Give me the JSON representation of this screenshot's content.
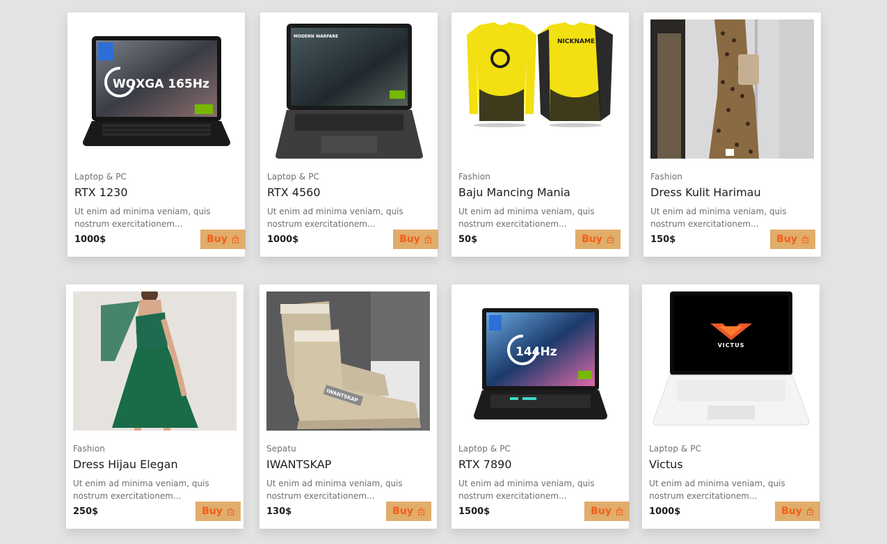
{
  "colors": {
    "background": "#e3e3e3",
    "card": "#ffffff",
    "buy_button_bg": "#e0ad6b",
    "buy_button_text": "#f35d1a"
  },
  "buy_label": "Buy",
  "products": [
    {
      "category": "Laptop & PC",
      "title": "RTX 1230",
      "description": "Ut enim ad minima veniam, quis nostrum exercitationem...",
      "price": "1000$",
      "image_text": "WQXGA 165Hz",
      "image": "laptop-black-gaming"
    },
    {
      "category": "Laptop & PC",
      "title": "RTX 4560",
      "description": "Ut enim ad minima veniam, quis nostrum exercitationem...",
      "price": "1000$",
      "image_text": "MODERN WARFARE",
      "image": "laptop-gray-gaming"
    },
    {
      "category": "Fashion",
      "title": "Baju Mancing Mania",
      "description": "Ut enim ad minima veniam, quis nostrum exercitationem...",
      "price": "50$",
      "image_text": "NICKNAME",
      "image": "yellow-fishing-jersey"
    },
    {
      "category": "Fashion",
      "title": "Dress Kulit Harimau",
      "description": "Ut enim ad minima veniam, quis nostrum exercitationem...",
      "price": "150$",
      "image": "leopard-print-dress"
    },
    {
      "category": "Fashion",
      "title": "Dress Hijau Elegan",
      "description": "Ut enim ad minima veniam, quis nostrum exercitationem...",
      "price": "250$",
      "image": "green-dress"
    },
    {
      "category": "Sepatu",
      "title": "IWANTSKAP",
      "description": "Ut enim ad minima veniam, quis nostrum exercitationem...",
      "price": "130$",
      "image_text": "IWANTSKAP",
      "image": "beige-boots"
    },
    {
      "category": "Laptop & PC",
      "title": "RTX 7890",
      "description": "Ut enim ad minima veniam, quis nostrum exercitationem...",
      "price": "1500$",
      "image_text": "144Hz",
      "image": "laptop-blue-gaming"
    },
    {
      "category": "Laptop & PC",
      "title": "Victus",
      "description": "Ut enim ad minima veniam, quis nostrum exercitationem...",
      "price": "1000$",
      "image_text": "VICTUS",
      "image": "laptop-white-victus"
    }
  ]
}
